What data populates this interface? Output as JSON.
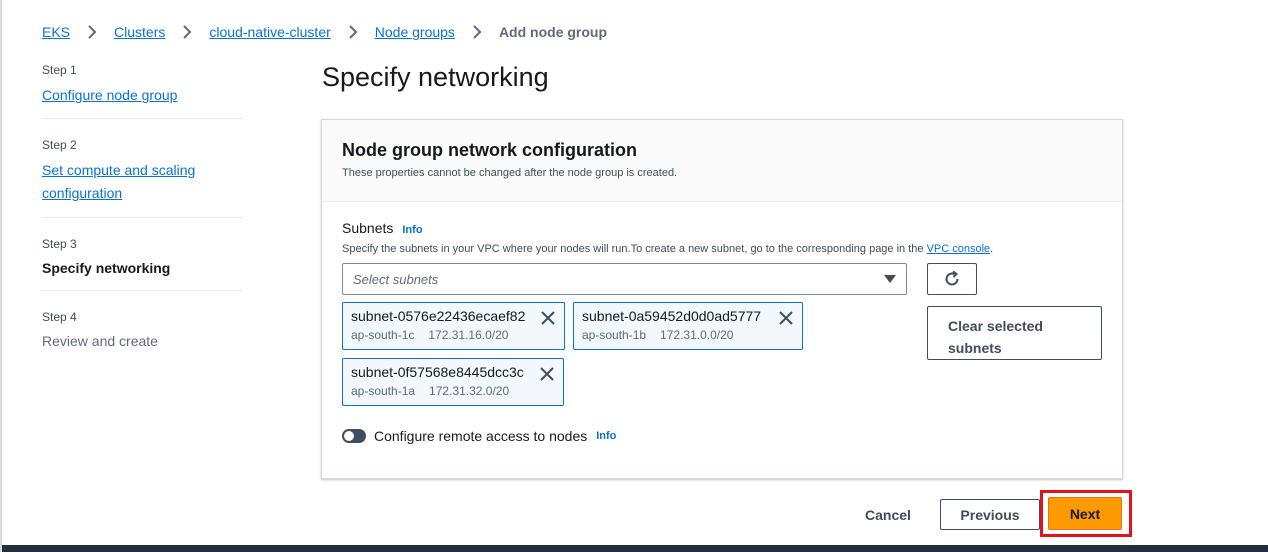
{
  "breadcrumb": {
    "items": [
      "EKS",
      "Clusters",
      "cloud-native-cluster",
      "Node groups"
    ],
    "current": "Add node group"
  },
  "steps": [
    {
      "number": "Step 1",
      "label": "Configure node group",
      "state": "link"
    },
    {
      "number": "Step 2",
      "label": "Set compute and scaling configuration",
      "label_line1": "Set compute and scaling",
      "label_line2": "configuration",
      "state": "link"
    },
    {
      "number": "Step 3",
      "label": "Specify networking",
      "state": "active"
    },
    {
      "number": "Step 4",
      "label": "Review and create",
      "state": "disabled"
    }
  ],
  "page": {
    "title": "Specify networking"
  },
  "network_config": {
    "title": "Node group network configuration",
    "description": "These properties cannot be changed after the node group is created.",
    "subnets": {
      "label": "Subnets",
      "info": "Info",
      "description_prefix": "Specify the subnets in your VPC where your nodes will run.To create a new subnet, go to the corresponding page in the ",
      "vpc_link": "VPC console",
      "description_suffix": ".",
      "placeholder": "Select subnets",
      "selected": [
        {
          "id": "subnet-0576e22436ecaef82",
          "az": "ap-south-1c",
          "cidr": "172.31.16.0/20"
        },
        {
          "id": "subnet-0a59452d0d0ad5777",
          "az": "ap-south-1b",
          "cidr": "172.31.0.0/20"
        },
        {
          "id": "subnet-0f57568e8445dcc3c",
          "az": "ap-south-1a",
          "cidr": "172.31.32.0/20"
        }
      ],
      "clear_label_line1": "Clear selected",
      "clear_label_line2": "subnets"
    },
    "remote_access": {
      "label": "Configure remote access to nodes",
      "info": "Info",
      "enabled": false
    }
  },
  "footer": {
    "cancel": "Cancel",
    "previous": "Previous",
    "next": "Next"
  },
  "colors": {
    "primary_button": "#ff9900",
    "link": "#0972d3",
    "highlight": "#e0121e"
  }
}
